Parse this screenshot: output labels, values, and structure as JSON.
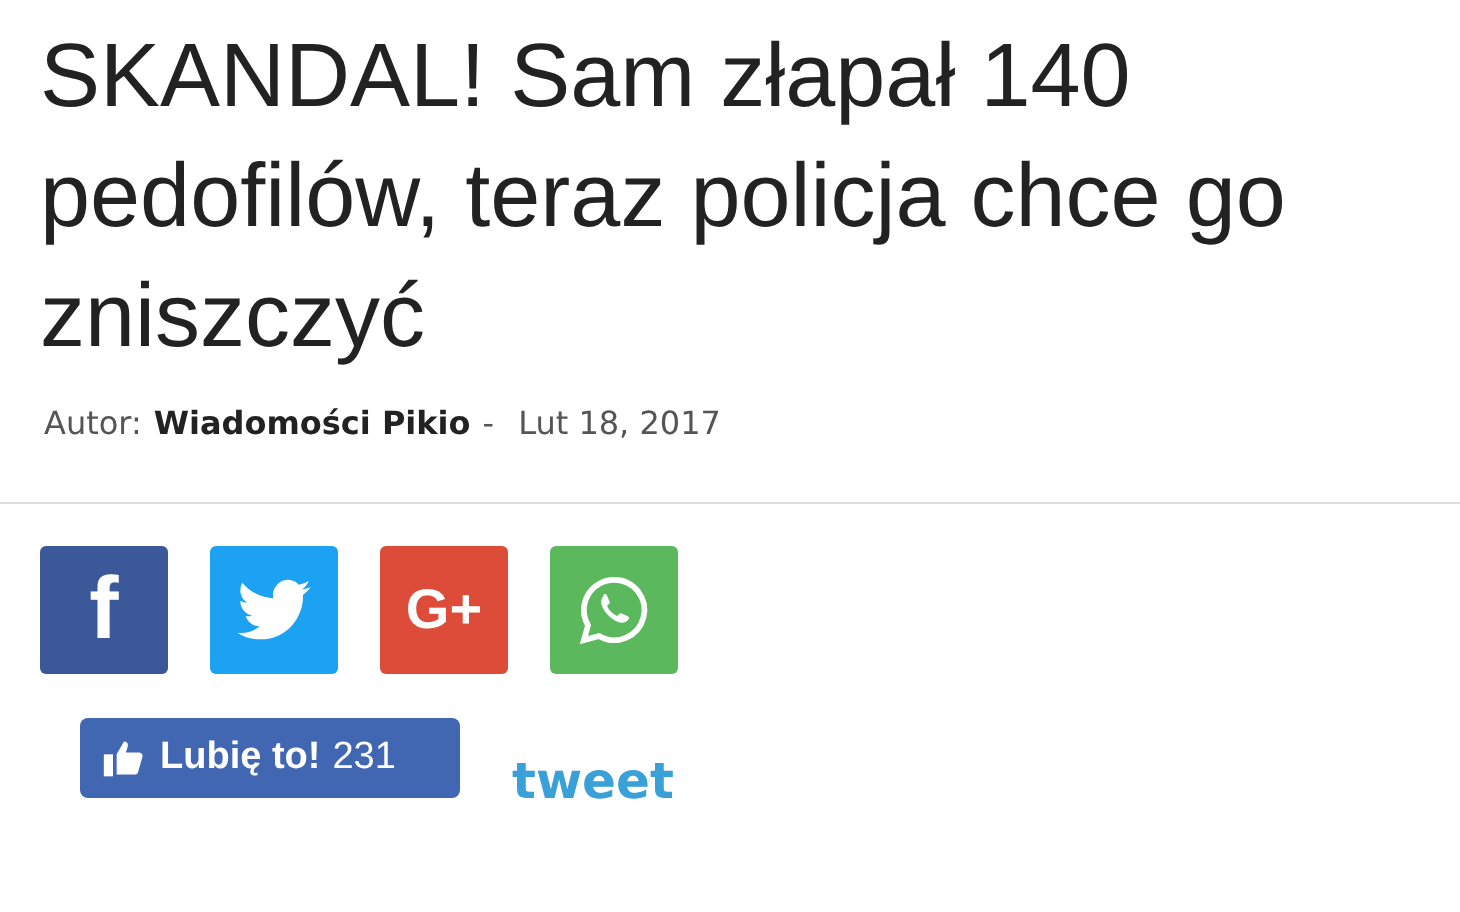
{
  "article": {
    "title": "SKANDAL! Sam złapał 140 pedofilów, teraz policja chce go zniszczyć",
    "author_label": "Autor:",
    "author": "Wiadomości Pikio",
    "separator": "-",
    "date": "Lut 18, 2017"
  },
  "share_buttons": [
    {
      "kind": "facebook",
      "glyph": "f",
      "color": "#3b5998"
    },
    {
      "kind": "twitter",
      "color": "#1da1f2"
    },
    {
      "kind": "googleplus",
      "glyph": "G+",
      "color": "#dd4b39"
    },
    {
      "kind": "whatsapp",
      "color": "#5cb85c"
    }
  ],
  "like_button": {
    "label": "Lubię to!",
    "count": "231"
  },
  "tweet_link": "tweet"
}
